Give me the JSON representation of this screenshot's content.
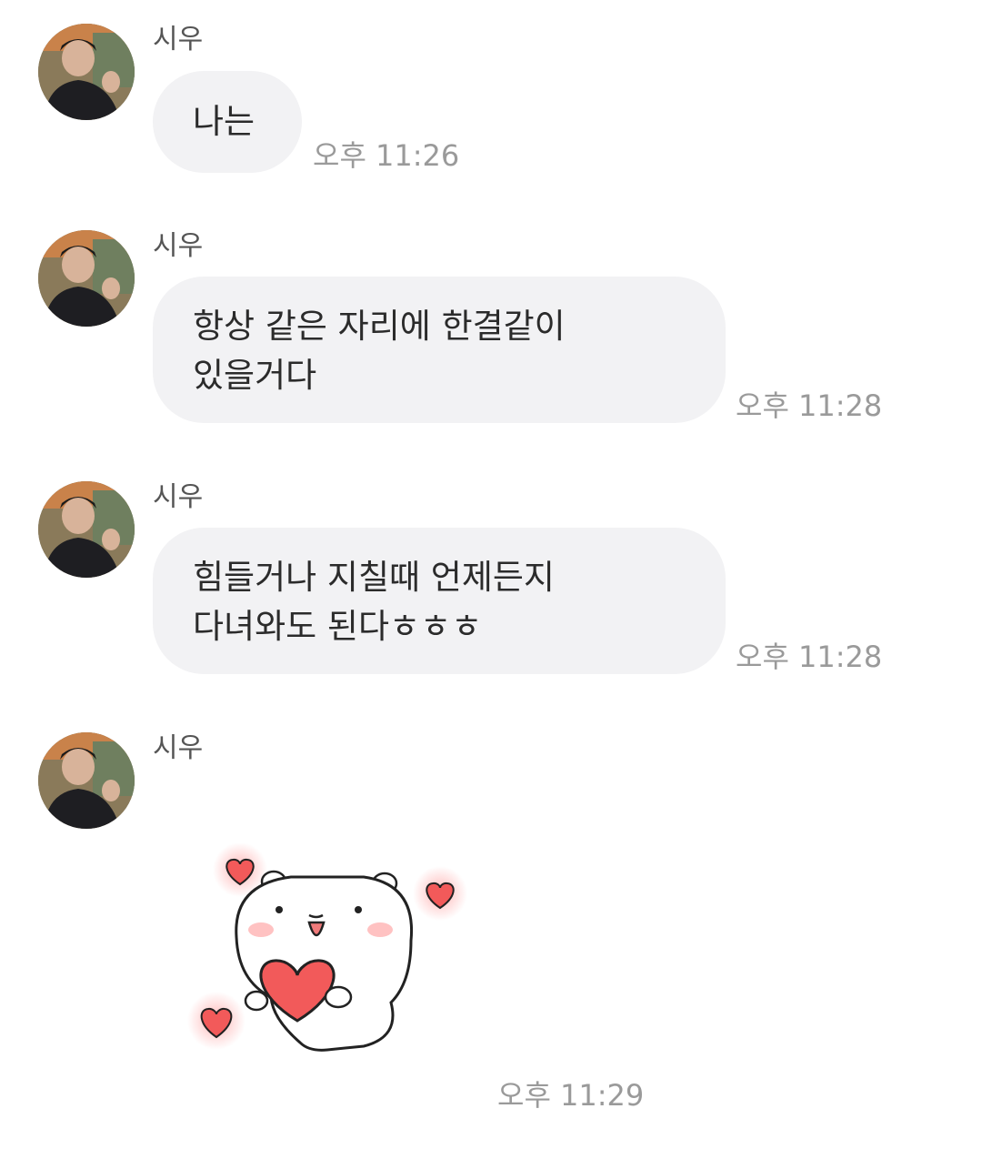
{
  "messages": [
    {
      "sender": "시우",
      "text": "나는",
      "time": "오후 11:26"
    },
    {
      "sender": "시우",
      "text": "항상 같은 자리에 한결같이\n있을거다",
      "time": "오후 11:28"
    },
    {
      "sender": "시우",
      "text": "힘들거나 지칠때 언제든지\n다녀와도 된다ㅎㅎㅎ",
      "time": "오후 11:28"
    },
    {
      "sender": "시우",
      "sticker": "bear-holding-heart-sticker",
      "time": "오후 11:29"
    }
  ],
  "colors": {
    "bubble": "#f2f2f4",
    "time": "#9a9a9a",
    "sender": "#555555",
    "heart": "#f25a5a"
  }
}
